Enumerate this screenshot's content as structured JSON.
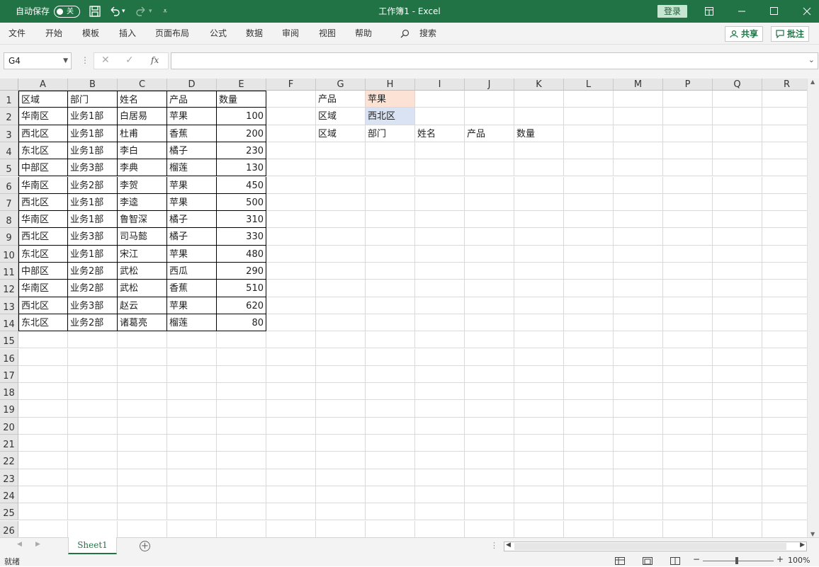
{
  "titlebar": {
    "autosave_label": "自动保存",
    "autosave_state": "关",
    "title": "工作簿1  -  Excel",
    "login": "登录"
  },
  "ribbon": {
    "tabs": [
      "文件",
      "开始",
      "模板",
      "插入",
      "页面布局",
      "公式",
      "数据",
      "审阅",
      "视图",
      "帮助"
    ],
    "search": "搜索",
    "share": "共享",
    "comments": "批注"
  },
  "formula_bar": {
    "name_box": "G4",
    "fx": "fx",
    "formula": ""
  },
  "columns": [
    "A",
    "B",
    "C",
    "D",
    "E",
    "F",
    "G",
    "H",
    "I",
    "J",
    "K",
    "L",
    "M",
    "P",
    "Q",
    "R"
  ],
  "rows": [
    "1",
    "2",
    "3",
    "4",
    "5",
    "6",
    "7",
    "8",
    "9",
    "10",
    "11",
    "12",
    "13",
    "14",
    "15",
    "16",
    "17",
    "18",
    "19",
    "20",
    "21",
    "22",
    "23",
    "24",
    "25",
    "26"
  ],
  "table": {
    "header": [
      "区域",
      "部门",
      "姓名",
      "产品",
      "数量"
    ],
    "rows": [
      [
        "华南区",
        "业务1部",
        "白居易",
        "苹果",
        "100"
      ],
      [
        "西北区",
        "业务1部",
        "杜甫",
        "香蕉",
        "200"
      ],
      [
        "东北区",
        "业务1部",
        "李白",
        "橘子",
        "230"
      ],
      [
        "中部区",
        "业务3部",
        "李典",
        "榴莲",
        "130"
      ],
      [
        "华南区",
        "业务2部",
        "李贺",
        "苹果",
        "450"
      ],
      [
        "西北区",
        "业务1部",
        "李逵",
        "苹果",
        "500"
      ],
      [
        "华南区",
        "业务1部",
        "鲁智深",
        "橘子",
        "310"
      ],
      [
        "西北区",
        "业务3部",
        "司马懿",
        "橘子",
        "330"
      ],
      [
        "东北区",
        "业务1部",
        "宋江",
        "苹果",
        "480"
      ],
      [
        "中部区",
        "业务2部",
        "武松",
        "西瓜",
        "290"
      ],
      [
        "华南区",
        "业务2部",
        "武松",
        "香蕉",
        "510"
      ],
      [
        "西北区",
        "业务3部",
        "赵云",
        "苹果",
        "620"
      ],
      [
        "东北区",
        "业务2部",
        "诸葛亮",
        "榴莲",
        "80"
      ]
    ]
  },
  "criteria": {
    "product_label": "产品",
    "product_value": "苹果",
    "region_label": "区域",
    "region_value": "西北区",
    "result_headers": [
      "区域",
      "部门",
      "姓名",
      "产品",
      "数量"
    ]
  },
  "sheet_tabs": [
    "Sheet1"
  ],
  "status": {
    "ready": "就绪",
    "zoom": "100%"
  },
  "colors": {
    "brand": "#217346",
    "criteria_orange": "#fbe2d5",
    "criteria_blue": "#dae3f3"
  }
}
